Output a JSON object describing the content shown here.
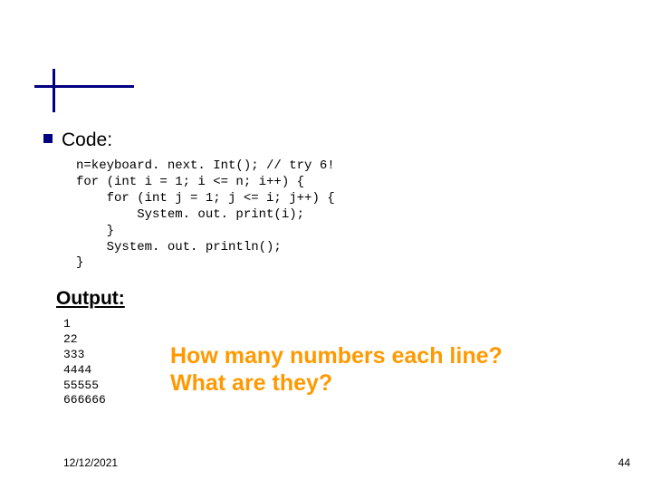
{
  "section_code_label": "Code:",
  "code_lines": "n=keyboard. next. Int(); // try 6!\nfor (int i = 1; i <= n; i++) {\n    for (int j = 1; j <= i; j++) {\n        System. out. print(i);\n    }\n    System. out. println();\n}",
  "section_output_label": "Output:",
  "output_lines": "1\n22\n333\n4444\n55555\n666666",
  "question1": "How many numbers each line?",
  "question2": "What are they?",
  "footer": {
    "date": "12/12/2021",
    "page": "44"
  }
}
